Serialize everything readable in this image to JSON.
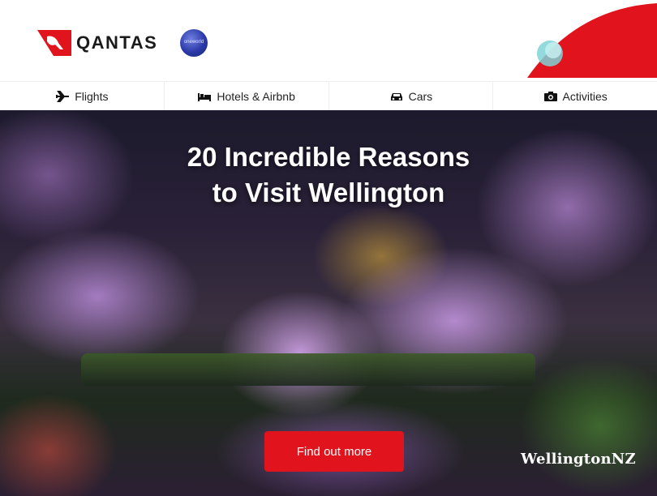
{
  "header": {
    "brand_name": "QANTAS",
    "alliance_badge": "oneworld"
  },
  "nav": {
    "items": [
      {
        "label": "Flights",
        "icon": "airplane-icon"
      },
      {
        "label": "Hotels & Airbnb",
        "icon": "bed-icon"
      },
      {
        "label": "Cars",
        "icon": "car-icon"
      },
      {
        "label": "Activities",
        "icon": "camera-icon"
      }
    ]
  },
  "hero": {
    "title_line1": "20 Incredible Reasons",
    "title_line2": "to Visit Wellington",
    "cta_label": "Find out more",
    "partner_logo": "WellingtonNZ"
  },
  "colors": {
    "brand_red": "#e1131d",
    "text_dark": "#222222",
    "hero_text": "#ffffff"
  }
}
